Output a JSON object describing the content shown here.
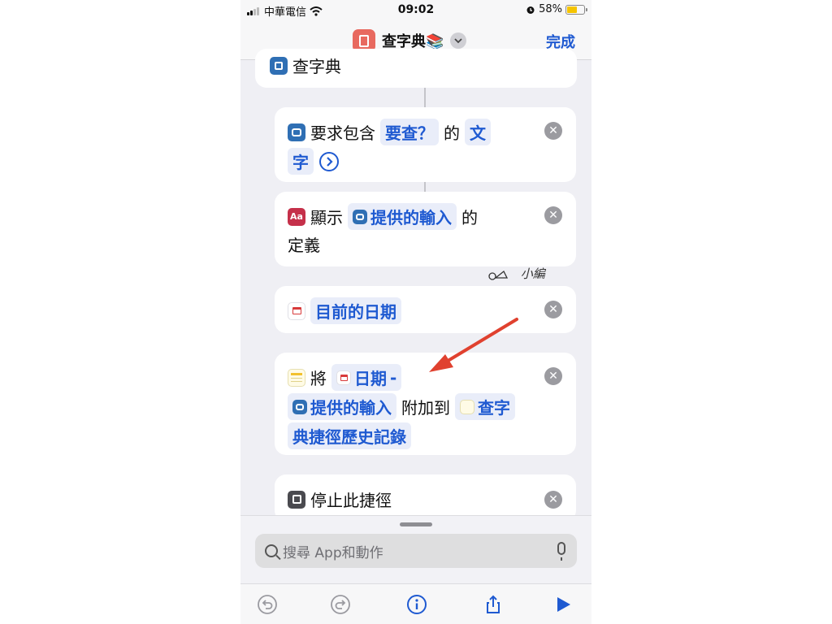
{
  "status_bar": {
    "carrier": "中華電信",
    "time": "09:02",
    "battery": "58%"
  },
  "nav": {
    "title": "查字典📚",
    "done": "完成"
  },
  "cards": {
    "top": {
      "label": "查字典"
    },
    "ask": {
      "prefix": "要求包含",
      "prompt": "要查？",
      "mid": "的",
      "type_a": "文",
      "type_b": "字"
    },
    "show": {
      "prefix": "顯示",
      "token": "提供的輸入",
      "suffix": "的",
      "line2": "定義"
    },
    "date": {
      "token": "目前的日期"
    },
    "append": {
      "prefix": "將",
      "date_token": "日期",
      "dash": "-",
      "input_token": "提供的輸入",
      "middle": "附加到",
      "target_a": "查字",
      "target_b": "典捷徑歷史記錄"
    },
    "stop": {
      "label": "停止此捷徑"
    }
  },
  "watermark": "小編",
  "search": {
    "placeholder": "搜尋 App和動作"
  },
  "colors": {
    "accent": "#1f5ad1",
    "arrow": "#e0412f",
    "background": "#efeff4"
  },
  "icons": [
    "wifi-icon",
    "alarm-icon",
    "book-icon",
    "chevron-down-icon",
    "text-input-icon",
    "chevron-right-circle-icon",
    "dictionary-icon",
    "calendar-icon",
    "notes-icon",
    "stop-icon",
    "remove-icon",
    "search-icon",
    "microphone-icon",
    "undo-icon",
    "redo-icon",
    "info-icon",
    "share-icon",
    "play-icon"
  ]
}
